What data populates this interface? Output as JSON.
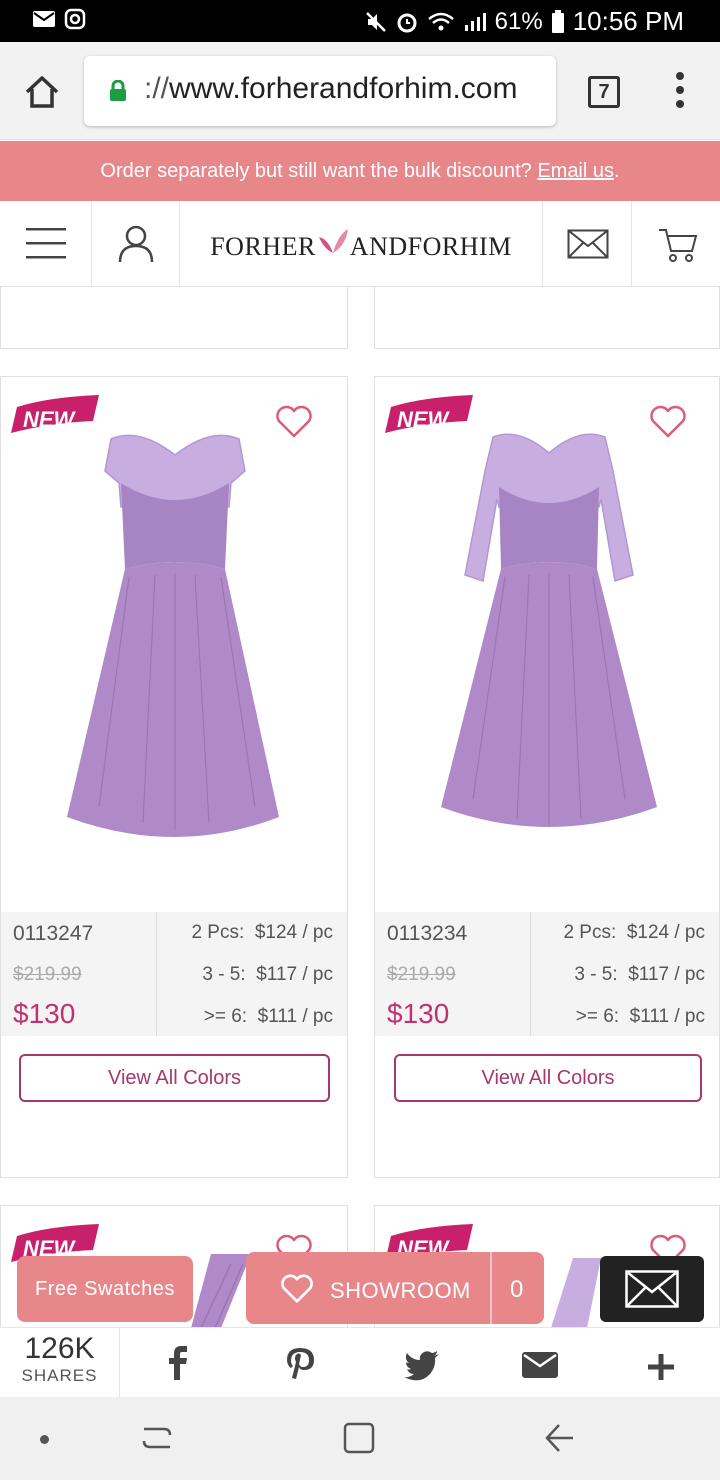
{
  "status_bar": {
    "battery": "61%",
    "time": "10:56 PM"
  },
  "browser": {
    "url_scheme": "://",
    "url_host": "www.forherandforhim.com",
    "tab_count": "7"
  },
  "promo": {
    "text": "Order separately but still want the bulk discount?",
    "link": "Email us",
    "suffix": "."
  },
  "header": {
    "logo_left": "FORHER",
    "logo_right": "ANDFORHIM"
  },
  "products": [
    {
      "badge": "NEW",
      "sku": "0113247",
      "old_price": "$219.99",
      "price": "$130",
      "tiers": [
        {
          "qty": "2 Pcs:",
          "price": "$124 / pc"
        },
        {
          "qty": "3 - 5:",
          "price": "$117 / pc"
        },
        {
          "qty": ">= 6:",
          "price": "$111 / pc"
        }
      ],
      "button": "View All Colors"
    },
    {
      "badge": "NEW",
      "sku": "0113234",
      "old_price": "$219.99",
      "price": "$130",
      "tiers": [
        {
          "qty": "2 Pcs:",
          "price": "$124 / pc"
        },
        {
          "qty": "3 - 5:",
          "price": "$117 / pc"
        },
        {
          "qty": ">= 6:",
          "price": "$111 / pc"
        }
      ],
      "button": "View All Colors"
    },
    {
      "badge": "NEW"
    },
    {
      "badge": "NEW"
    }
  ],
  "floating": {
    "swatches": "Free Swatches",
    "showroom": "SHOWROOM",
    "showroom_count": "0"
  },
  "share_bar": {
    "count": "126K",
    "label": "SHARES",
    "icons": [
      "facebook-icon",
      "pinterest-icon",
      "twitter-icon",
      "email-icon",
      "plus-icon"
    ]
  },
  "colors": {
    "accent": "#e8878a",
    "price": "#c2306f",
    "button_border": "#a6386a",
    "badge": "#c8206b",
    "dress": "#b08ac8"
  }
}
